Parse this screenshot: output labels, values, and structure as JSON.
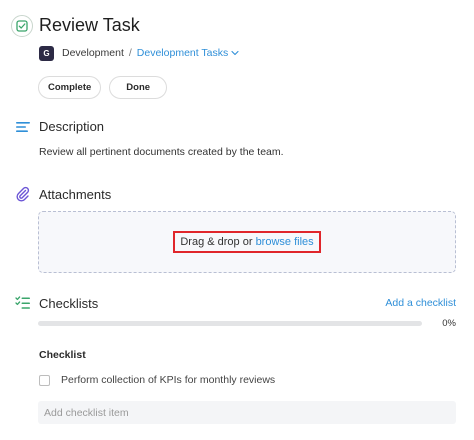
{
  "task": {
    "title": "Review Task",
    "project_initial": "G",
    "project_name": "Development",
    "breadcrumb_sep": "/",
    "task_list": "Development Tasks"
  },
  "actions": {
    "complete_label": "Complete",
    "done_label": "Done"
  },
  "description": {
    "heading": "Description",
    "text": "Review all pertinent documents created by the team."
  },
  "attachments": {
    "heading": "Attachments",
    "drop_text": "Drag & drop or ",
    "browse_text": "browse files"
  },
  "checklists": {
    "heading": "Checklists",
    "add_label": "Add a checklist",
    "progress": 0,
    "progress_label": "0%",
    "list_name": "Checklist",
    "items": [
      {
        "label": "Perform collection of KPIs for monthly reviews",
        "checked": false
      }
    ],
    "add_item_placeholder": "Add checklist item"
  },
  "colors": {
    "accent": "#2f8fd8",
    "highlight_border": "#e0262b",
    "section_icon": "#2f8fd8",
    "attach_icon": "#6b55d6",
    "checklist_icon": "#3aa56b",
    "task_icon": "#3aa56b"
  },
  "icons": {
    "task": "checkbox-circle-icon",
    "description": "text-lines-icon",
    "attachments": "paperclip-icon",
    "checklists": "checklist-icon",
    "task_list": "chevron-down-icon"
  }
}
